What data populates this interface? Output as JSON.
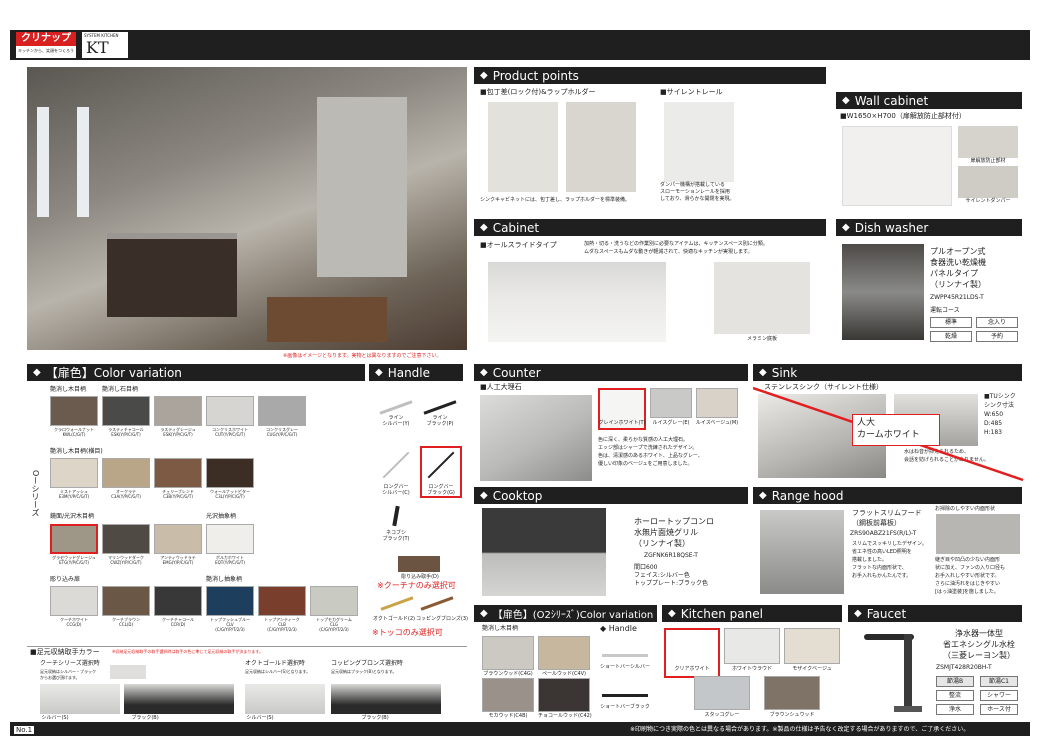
{
  "header": {
    "logo": "クリナップ",
    "tagline": "キッチンから、笑顔をつくろう",
    "series_top": "SYSTEM KITCHEN",
    "series": "KT"
  },
  "hero_note": "※画像はイメージとなります。実物とは異なりますのでご注意下さい。",
  "product_points": {
    "title": "Product points",
    "item1": "■包丁差(ロック付)&ラップホルダー",
    "item2": "■サイレントレール",
    "caption1": "シンクキャビネットには、包丁差し、ラップホルダーを標準装備。",
    "caption2": "ダンパー機構が搭載している\nスローモーションレールを採用\nしており、滑らかな開閉を実現。"
  },
  "wall_cabinet": {
    "title": "Wall cabinet",
    "spec": "■W1650×H700（扉解放防止部材付）",
    "label1": "扉解放防止部材",
    "label2": "サイレントダンパー"
  },
  "cabinet": {
    "title": "Cabinet",
    "type": "■オールスライドタイプ",
    "desc": "加熱・切る・洗うなどの作業別に必要なアイテムは、キッチンスペース別に分類。\nムダなスペースもムダな動きが軽減されて、快適なキッチンが実現します。",
    "note": "メラミン底板"
  },
  "dish_washer": {
    "title": "Dish washer",
    "desc": "プルオープン式\n食器洗い乾燥機\nパネルタイプ\n（リンナイ製）",
    "model": "ZWPP45R21LDS-T",
    "course_label": "運転コース",
    "buttons": [
      "標準",
      "念入り",
      "乾燥",
      "予約"
    ]
  },
  "color_variation": {
    "title": "【扉色】Color variation",
    "series_label": "Oーシリーズ",
    "g1_title": "艶消し木目柄",
    "g2_title": "艶消し石目柄",
    "g3_title": "艶消し木目柄(横目)",
    "g4_title": "鏡面/光沢木目柄",
    "g5_title": "光沢抽象柄",
    "g6_title": "彫り込み扉",
    "g7_title": "艶消し抽象柄",
    "row1": [
      {
        "name": "クラロウォールナット\nKWL(C/G/T)",
        "color": "#6b5a4e"
      },
      {
        "name": "ラスティチャコール\nESK(Y/P/C/G/T)",
        "color": "#4a4a48"
      },
      {
        "name": "ラスティグレージュ\nESK(Y/P/C/G/T)",
        "color": "#aaa49c"
      },
      {
        "name": "コンクリスホワイト\nCUT(Y/P/C/G/T)",
        "color": "#d7d5d1"
      },
      {
        "name": "コンクリスグレー\nCUG(Y/P/C/G/T)",
        "color": "#a8a9a8"
      }
    ],
    "row2": [
      {
        "name": "ミストアッシュ\nE3M(Y/P/C/G/T)",
        "color": "#ddd6c8"
      },
      {
        "name": "オークラテ\nC3A(Y/P/C/G/T)",
        "color": "#b9a689"
      },
      {
        "name": "チェリーブレンド\nC3B(Y/P/C/G/T)",
        "color": "#7d5a43"
      },
      {
        "name": "ウォールナットピター\nC3L(Y/P/C/G/T)",
        "color": "#3c2e25"
      }
    ],
    "row3": [
      {
        "name": "グラセウッドグレージュ\nETG(Y/P/C/G/T)",
        "color": "#9e9686"
      },
      {
        "name": "マリンウッドダーク\nCWZ(Y/P/C/G/T)",
        "color": "#4f4a44"
      },
      {
        "name": "アンティウッドラテ\nEMG(Y/P/C/G/T)",
        "color": "#c9bda9"
      },
      {
        "name": "ボルカホワイト\nEQT(Y/P/C/G/T)",
        "color": "#efeeea"
      }
    ],
    "row4": [
      {
        "name": "クーチホワイト\nCCG(D)",
        "color": "#dcdad6"
      },
      {
        "name": "クーチブラウン\nCCL(D)",
        "color": "#6a5746"
      },
      {
        "name": "クーチチャコール\nCCR(D)",
        "color": "#383838"
      },
      {
        "name": "トップフッシュブルー\nCLV\n(C/G/Y/P/T/2/3)",
        "color": "#1d3e5d"
      },
      {
        "name": "トップアンティーク\nCLB\n(C/G/Y/P/T/2/3)",
        "color": "#7a3f2c"
      },
      {
        "name": "トップモカグリーム\nCLG\n(C/G/Y/P/T/2/3)",
        "color": "#c9cbc3"
      }
    ]
  },
  "handle": {
    "title": "Handle",
    "items": [
      {
        "name": "ライン\nシルバー(Y)"
      },
      {
        "name": "ライン\nブラック(P)"
      },
      {
        "name": "ロングバー\nシルバー(C)"
      },
      {
        "name": "ロングバー\nブラック(G)"
      },
      {
        "name": "ネコブシ\nブラック(T)"
      }
    ],
    "knob_label": "彫り込み取手(D)",
    "note1": "※クーチナのみ選択可",
    "item_gold": "オクトゴールド(2)",
    "item_bronze": "コッピングブロンズ(3)",
    "note2": "※トッコのみ選択可"
  },
  "kick_color": {
    "title": "■足元収納取手カラー",
    "note": "※収納足元収納取手の取手選択時は取手の色に準じて足元収納の取手が決まります。",
    "c1_title": "クーチシリーズ選択時",
    "c1_desc": "足元収納はシルバー・ブラック\nからお選び頂けます。",
    "c2_title": "オクトゴールド選択時",
    "c2_desc": "足元収納はシルバー(S)となります。",
    "c3_title": "コッピングブロンズ選択時",
    "c3_desc": "足元収納はブラック(B)となります。",
    "labels": [
      "シルバー(S)",
      "ブラック(B)",
      "シルバー(S)",
      "ブラック(B)"
    ]
  },
  "counter": {
    "title": "Counter",
    "type": "■人工大理石",
    "swatches": [
      {
        "name": "グレインホワイト(T)",
        "color": "#f5f5f3"
      },
      {
        "name": "ルイスグレー(E)",
        "color": "#c9c9c7"
      },
      {
        "name": "ルイスベージュ(M)",
        "color": "#d9d2c8"
      }
    ],
    "desc": "色に深く、柔らかな質感の人工大理石。\nエッジ部はシャープで洗練されたデザイン。\n色は、清潔感のあるホワイト、上品なグレー、\n優しい印象のベージュをご用意しました。"
  },
  "sink": {
    "title": "Sink",
    "type": "ステンレスシンク（サイレント仕様）",
    "overlay_line1": "人大",
    "overlay_line2": "カームホワイト",
    "spec": "■TUシンク\nシンク寸法\nW:650\nD:485\nH:183",
    "desc": "水はね音が抑えられるため、\n会話を妨げられることがありません。"
  },
  "cooktop": {
    "title": "Cooktop",
    "desc": "ホーロートップコンロ\n水無片面焼グリル\n（リンナイ製）",
    "model": "ZGFNK6R18QSE-T",
    "spec": "間口600\nフェイス:シルバー色\nトッププレート:ブラック色"
  },
  "range_hood": {
    "title": "Range hood",
    "name": "フラットスリムフード\n（鋼板前幕板）",
    "model": "ZRS90ABZ21FS(R/L)-T",
    "desc": "スリムでスッキリしたデザイン。\n省エネ性の高いLED照明を\n搭載しました。\nフラットな内面形状で、\nお手入れもかんたんです。",
    "care_title": "お掃除のしやすい内面形状",
    "care_desc": "継ぎ目や凹凸の少ない内面形\n状に加え、ファンの入り口径も\nお手入れしやすい形状です。\nさらに油汚れをはじきやすい\n[はっ油塗装]を施しました。"
  },
  "o2_color": {
    "title": "【扉色】(O2ｼﾘｰｽﾞ)Color variation",
    "group": "艶消し木目柄",
    "handle_title": "Handle",
    "swatches": [
      {
        "name": "ブラウンウッド(C4G)",
        "color": "#ccc8c2"
      },
      {
        "name": "ペールウッド(C4V)",
        "color": "#c7b79f"
      },
      {
        "name": "モカウッド(C4B)",
        "color": "#9a928a"
      },
      {
        "name": "チョコールウッド(C42)",
        "color": "#3b3633"
      }
    ],
    "handles": [
      "ショートバーシルバー",
      "ショートバーブラック"
    ]
  },
  "kitchen_panel": {
    "title": "Kitchen panel",
    "swatches": [
      {
        "name": "クリアホワイト",
        "color": "#ffffff"
      },
      {
        "name": "ホワイトウラウド",
        "color": "#e8e8e6"
      },
      {
        "name": "モザイクベージュ",
        "color": "#e3ddd2"
      },
      {
        "name": "スタッコグレー",
        "color": "#c4c7c9"
      },
      {
        "name": "ブラウンシュウッド",
        "color": "#7f7266"
      }
    ]
  },
  "faucet": {
    "title": "Faucet",
    "desc": "浄水器一体型\n省エネシングル水栓\n（三菱レーヨン製）",
    "model": "ZSMJT428R20BH-T",
    "buttons": [
      "節湯B",
      "節湯C1",
      "整流",
      "シャワー",
      "浄水",
      "ホース付"
    ]
  },
  "footer": {
    "page": "No.1",
    "note": "※印刷物につき実際の色とは異なる場合があります。※製品の仕様は予告なく改定する場合がありますので、ご了承ください。"
  }
}
